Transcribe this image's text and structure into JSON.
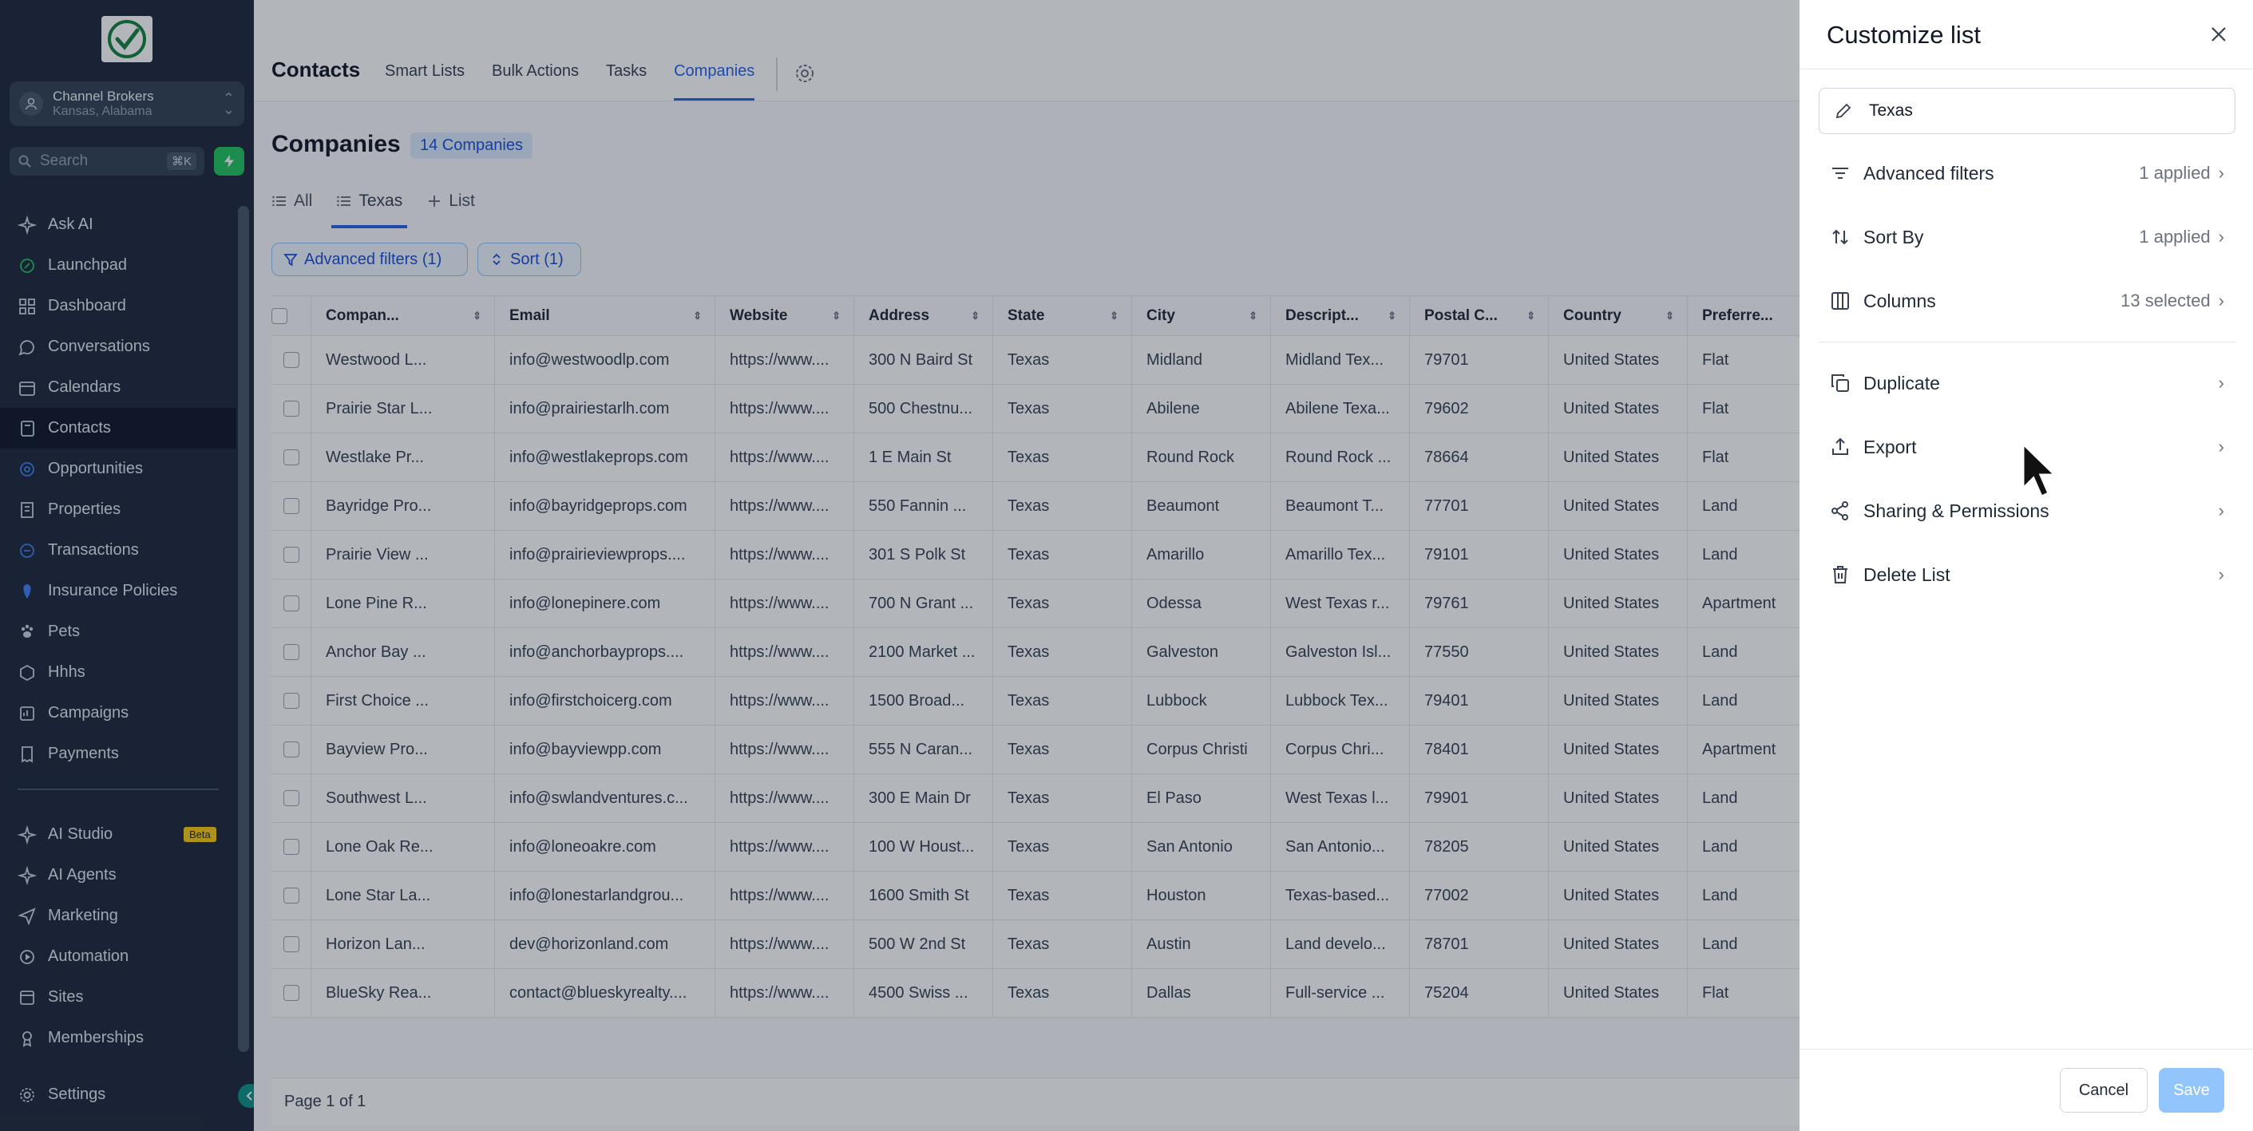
{
  "account": {
    "name": "Channel Brokers",
    "location": "Kansas, Alabama"
  },
  "search": {
    "placeholder": "Search",
    "shortcut": "⌘K"
  },
  "sidebar": {
    "items": [
      {
        "label": "Ask AI",
        "icon": "sparkle-icon"
      },
      {
        "label": "Launchpad",
        "icon": "rocket-icon"
      },
      {
        "label": "Dashboard",
        "icon": "grid-icon"
      },
      {
        "label": "Conversations",
        "icon": "chat-icon"
      },
      {
        "label": "Calendars",
        "icon": "calendar-icon"
      },
      {
        "label": "Contacts",
        "icon": "contacts-icon"
      },
      {
        "label": "Opportunities",
        "icon": "target-icon"
      },
      {
        "label": "Properties",
        "icon": "building-icon"
      },
      {
        "label": "Transactions",
        "icon": "coins-icon"
      },
      {
        "label": "Insurance Policies",
        "icon": "lightbulb-icon"
      },
      {
        "label": "Pets",
        "icon": "paw-icon"
      },
      {
        "label": "Hhhs",
        "icon": "cube-icon"
      },
      {
        "label": "Campaigns",
        "icon": "megaphone-icon"
      },
      {
        "label": "Payments",
        "icon": "receipt-icon"
      }
    ],
    "items2": [
      {
        "label": "AI Studio",
        "icon": "sparkle-icon",
        "badge": "Beta"
      },
      {
        "label": "AI Agents",
        "icon": "sparkle-icon"
      },
      {
        "label": "Marketing",
        "icon": "send-icon"
      },
      {
        "label": "Automation",
        "icon": "workflow-icon"
      },
      {
        "label": "Sites",
        "icon": "globe-icon"
      },
      {
        "label": "Memberships",
        "icon": "graduation-icon"
      }
    ],
    "settings": "Settings",
    "active": "Contacts"
  },
  "header": {
    "title": "Contacts",
    "tabs": [
      "Smart Lists",
      "Bulk Actions",
      "Tasks",
      "Companies"
    ],
    "active_tab": "Companies"
  },
  "page": {
    "title": "Companies",
    "count": "14 Companies",
    "views": [
      "All",
      "Texas",
      "List"
    ],
    "active_view": "Texas",
    "filter_chip": "Advanced filters (1)",
    "sort_chip": "Sort (1)",
    "pagination": "Page 1 of 1"
  },
  "table": {
    "columns": [
      "Compan...",
      "Email",
      "Website",
      "Address",
      "State",
      "City",
      "Descript...",
      "Postal C...",
      "Country",
      "Preferre..."
    ],
    "rows": [
      [
        "Westwood L...",
        "info@westwoodlp.com",
        "https://www....",
        "300 N Baird St",
        "Texas",
        "Midland",
        "Midland Tex...",
        "79701",
        "United States",
        "Flat"
      ],
      [
        "Prairie Star L...",
        "info@prairiestarlh.com",
        "https://www....",
        "500 Chestnu...",
        "Texas",
        "Abilene",
        "Abilene Texa...",
        "79602",
        "United States",
        "Flat"
      ],
      [
        "Westlake Pr...",
        "info@westlakeprops.com",
        "https://www....",
        "1 E Main St",
        "Texas",
        "Round Rock",
        "Round Rock ...",
        "78664",
        "United States",
        "Flat"
      ],
      [
        "Bayridge Pro...",
        "info@bayridgeprops.com",
        "https://www....",
        "550 Fannin ...",
        "Texas",
        "Beaumont",
        "Beaumont T...",
        "77701",
        "United States",
        "Land"
      ],
      [
        "Prairie View ...",
        "info@prairieviewprops....",
        "https://www....",
        "301 S Polk St",
        "Texas",
        "Amarillo",
        "Amarillo Tex...",
        "79101",
        "United States",
        "Land"
      ],
      [
        "Lone Pine R...",
        "info@lonepinere.com",
        "https://www....",
        "700 N Grant ...",
        "Texas",
        "Odessa",
        "West Texas r...",
        "79761",
        "United States",
        "Apartment"
      ],
      [
        "Anchor Bay ...",
        "info@anchorbayprops....",
        "https://www....",
        "2100 Market ...",
        "Texas",
        "Galveston",
        "Galveston Isl...",
        "77550",
        "United States",
        "Land"
      ],
      [
        "First Choice ...",
        "info@firstchoicerg.com",
        "https://www....",
        "1500 Broad...",
        "Texas",
        "Lubbock",
        "Lubbock Tex...",
        "79401",
        "United States",
        "Land"
      ],
      [
        "Bayview Pro...",
        "info@bayviewpp.com",
        "https://www....",
        "555 N Caran...",
        "Texas",
        "Corpus Christi",
        "Corpus Chri...",
        "78401",
        "United States",
        "Apartment"
      ],
      [
        "Southwest L...",
        "info@swlandventures.c...",
        "https://www....",
        "300 E Main Dr",
        "Texas",
        "El Paso",
        "West Texas l...",
        "79901",
        "United States",
        "Land"
      ],
      [
        "Lone Oak Re...",
        "info@loneoakre.com",
        "https://www....",
        "100 W Houst...",
        "Texas",
        "San Antonio",
        "San Antonio...",
        "78205",
        "United States",
        "Land"
      ],
      [
        "Lone Star La...",
        "info@lonestarlandgrou...",
        "https://www....",
        "1600 Smith St",
        "Texas",
        "Houston",
        "Texas-based...",
        "77002",
        "United States",
        "Land"
      ],
      [
        "Horizon Lan...",
        "dev@horizonland.com",
        "https://www....",
        "500 W 2nd St",
        "Texas",
        "Austin",
        "Land develo...",
        "78701",
        "United States",
        "Land"
      ],
      [
        "BlueSky Rea...",
        "contact@blueskyrealty....",
        "https://www....",
        "4500 Swiss ...",
        "Texas",
        "Dallas",
        "Full-service ...",
        "75204",
        "United States",
        "Flat"
      ]
    ]
  },
  "drawer": {
    "title": "Customize list",
    "list_name": "Texas",
    "advanced_filters": {
      "label": "Advanced filters",
      "value": "1 applied"
    },
    "sort_by": {
      "label": "Sort By",
      "value": "1 applied"
    },
    "columns": {
      "label": "Columns",
      "value": "13 selected"
    },
    "duplicate": "Duplicate",
    "export": "Export",
    "sharing": "Sharing & Permissions",
    "delete": "Delete List",
    "cancel": "Cancel",
    "save": "Save"
  },
  "colors": {
    "sidebar": "#1e293b",
    "accent": "#2563eb",
    "save_disabled": "#93c5fd"
  }
}
